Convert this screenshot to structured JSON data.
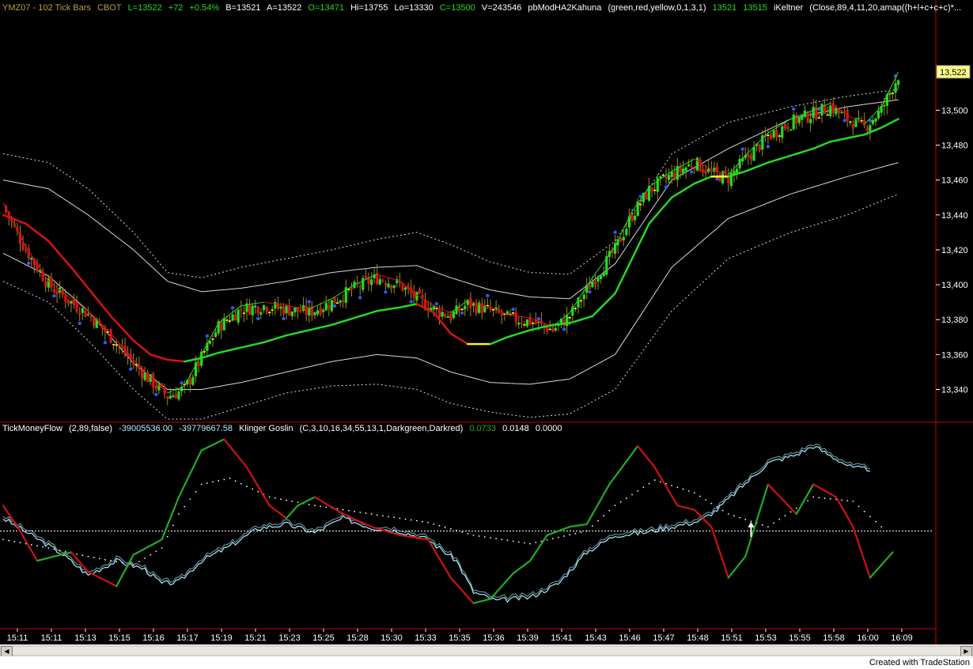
{
  "colors": {
    "background": "#000000",
    "up_candle": "#22dd22",
    "down_candle": "#dd1111",
    "neutral_candle": "#ffff00",
    "wick": "#a08c20",
    "dot": "#3355ff",
    "ma_green": "#22dd22",
    "ma_red": "#dd1111",
    "ma_yellow": "#ffff00",
    "band": "#d8d8d8",
    "moneyflow": "#aaeeff",
    "klinger_up": "#22aa22",
    "klinger_down": "#cc1111",
    "axis_line": "#cc0000"
  },
  "header": {
    "symbol": "YMZ07 - 102 Tick Bars",
    "exchange": "CBOT",
    "last": "L=13522",
    "change": "+72",
    "change_pct": "+0.54%",
    "bid": "B=13521",
    "ask": "A=13522",
    "open": "O=13471",
    "high": "Hi=13755",
    "low": "Lo=13330",
    "close": "C=13500",
    "volume": "V=243546",
    "study1": "pbModHA2Kahuna",
    "study1_params": "(green,red,yellow,0,1,3,1)",
    "study1_v1": "13521",
    "study1_v2": "13515",
    "study2": "iKeltner",
    "study2_params": "(Close,89,4,11,20,amap((h+l+c+c+c)*..."
  },
  "sub_header": {
    "study1": "TickMoneyFlow",
    "study1_params": "(2,89,false)",
    "study1_v1": "-39005536.00",
    "study1_v2": "-39779667.58",
    "study2": "Klinger Goslin",
    "study2_params": "(C,3,10,16,34,55,13,1,Darkgreen,Darkred)",
    "study2_v1": "0.0733",
    "study2_v2": "0.0148",
    "study2_v3": "0.0000"
  },
  "footer": {
    "text": "Created with TradeStation"
  },
  "chart_data": [
    {
      "type": "candlestick",
      "title": "",
      "price_label": "13,522",
      "y_ticks": [
        "13,340",
        "13,360",
        "13,380",
        "13,400",
        "13,420",
        "13,440",
        "13,460",
        "13,480",
        "13,500"
      ],
      "y_tick_values": [
        13340,
        13360,
        13380,
        13400,
        13420,
        13440,
        13460,
        13480,
        13500
      ],
      "ylim": [
        13323,
        13555
      ],
      "last_price": 13522,
      "x_ticks": [
        "15:11",
        "15:11",
        "15:13",
        "15:15",
        "15:16",
        "15:17",
        "15:19",
        "15:21",
        "15:23",
        "15:25",
        "15:28",
        "15:30",
        "15:33",
        "15:35",
        "15:36",
        "15:39",
        "15:41",
        "15:43",
        "15:46",
        "15:47",
        "15:48",
        "15:51",
        "15:53",
        "15:55",
        "15:58",
        "16:00",
        "16:09"
      ],
      "close_path": [
        [
          0,
          13445
        ],
        [
          8,
          13420
        ],
        [
          16,
          13400
        ],
        [
          24,
          13390
        ],
        [
          30,
          13383
        ],
        [
          38,
          13370
        ],
        [
          46,
          13355
        ],
        [
          52,
          13345
        ],
        [
          58,
          13336
        ],
        [
          64,
          13340
        ],
        [
          70,
          13358
        ],
        [
          76,
          13376
        ],
        [
          84,
          13386
        ],
        [
          92,
          13388
        ],
        [
          100,
          13386
        ],
        [
          108,
          13384
        ],
        [
          116,
          13390
        ],
        [
          124,
          13398
        ],
        [
          132,
          13404
        ],
        [
          140,
          13400
        ],
        [
          146,
          13392
        ],
        [
          152,
          13386
        ],
        [
          158,
          13382
        ],
        [
          164,
          13389
        ],
        [
          172,
          13385
        ],
        [
          178,
          13381
        ],
        [
          186,
          13379
        ],
        [
          194,
          13374
        ],
        [
          200,
          13382
        ],
        [
          208,
          13402
        ],
        [
          216,
          13420
        ],
        [
          222,
          13440
        ],
        [
          228,
          13454
        ],
        [
          236,
          13463
        ],
        [
          244,
          13470
        ],
        [
          250,
          13464
        ],
        [
          256,
          13461
        ],
        [
          262,
          13472
        ],
        [
          270,
          13485
        ],
        [
          278,
          13493
        ],
        [
          286,
          13498
        ],
        [
          292,
          13502
        ],
        [
          298,
          13495
        ],
        [
          304,
          13490
        ],
        [
          310,
          13500
        ],
        [
          316,
          13520
        ]
      ],
      "ma_path": [
        [
          0,
          13440
        ],
        [
          8,
          13435
        ],
        [
          16,
          13425
        ],
        [
          24,
          13410
        ],
        [
          30,
          13398
        ],
        [
          38,
          13382
        ],
        [
          46,
          13368
        ],
        [
          52,
          13360
        ],
        [
          58,
          13357
        ],
        [
          64,
          13356
        ],
        [
          70,
          13358
        ],
        [
          76,
          13361
        ],
        [
          84,
          13364
        ],
        [
          92,
          13367
        ],
        [
          100,
          13371
        ],
        [
          108,
          13374
        ],
        [
          116,
          13377
        ],
        [
          124,
          13381
        ],
        [
          132,
          13385
        ],
        [
          140,
          13387
        ],
        [
          146,
          13389
        ],
        [
          152,
          13384
        ],
        [
          158,
          13372
        ],
        [
          164,
          13366
        ],
        [
          172,
          13366
        ],
        [
          178,
          13370
        ],
        [
          186,
          13374
        ],
        [
          194,
          13377
        ],
        [
          200,
          13378
        ],
        [
          208,
          13382
        ],
        [
          216,
          13395
        ],
        [
          222,
          13415
        ],
        [
          228,
          13435
        ],
        [
          236,
          13450
        ],
        [
          244,
          13458
        ],
        [
          250,
          13462
        ],
        [
          256,
          13462
        ],
        [
          262,
          13465
        ],
        [
          270,
          13470
        ],
        [
          278,
          13474
        ],
        [
          286,
          13478
        ],
        [
          292,
          13482
        ],
        [
          298,
          13484
        ],
        [
          304,
          13486
        ],
        [
          310,
          13490
        ],
        [
          316,
          13495
        ]
      ],
      "band_inner_upper_path": [
        [
          0,
          13460
        ],
        [
          16,
          13455
        ],
        [
          30,
          13440
        ],
        [
          46,
          13420
        ],
        [
          58,
          13402
        ],
        [
          70,
          13396
        ],
        [
          84,
          13398
        ],
        [
          100,
          13402
        ],
        [
          116,
          13407
        ],
        [
          132,
          13410
        ],
        [
          146,
          13411
        ],
        [
          158,
          13404
        ],
        [
          172,
          13397
        ],
        [
          186,
          13393
        ],
        [
          200,
          13392
        ],
        [
          216,
          13412
        ],
        [
          236,
          13460
        ],
        [
          256,
          13478
        ],
        [
          278,
          13495
        ],
        [
          298,
          13502
        ],
        [
          316,
          13506
        ]
      ],
      "band_inner_lower_path": [
        [
          0,
          13418
        ],
        [
          16,
          13405
        ],
        [
          30,
          13385
        ],
        [
          46,
          13355
        ],
        [
          58,
          13340
        ],
        [
          70,
          13340
        ],
        [
          84,
          13344
        ],
        [
          100,
          13350
        ],
        [
          116,
          13356
        ],
        [
          132,
          13360
        ],
        [
          146,
          13358
        ],
        [
          158,
          13350
        ],
        [
          172,
          13344
        ],
        [
          186,
          13343
        ],
        [
          200,
          13346
        ],
        [
          216,
          13360
        ],
        [
          236,
          13410
        ],
        [
          256,
          13438
        ],
        [
          278,
          13452
        ],
        [
          298,
          13462
        ],
        [
          316,
          13470
        ]
      ],
      "band_outer_upper_path": [
        [
          0,
          13475
        ],
        [
          16,
          13470
        ],
        [
          30,
          13455
        ],
        [
          46,
          13430
        ],
        [
          58,
          13407
        ],
        [
          70,
          13404
        ],
        [
          84,
          13410
        ],
        [
          100,
          13415
        ],
        [
          116,
          13420
        ],
        [
          132,
          13426
        ],
        [
          146,
          13430
        ],
        [
          158,
          13423
        ],
        [
          172,
          13413
        ],
        [
          186,
          13407
        ],
        [
          200,
          13406
        ],
        [
          216,
          13425
        ],
        [
          236,
          13475
        ],
        [
          256,
          13493
        ],
        [
          278,
          13502
        ],
        [
          298,
          13508
        ],
        [
          316,
          13512
        ]
      ],
      "band_outer_lower_path": [
        [
          0,
          13402
        ],
        [
          16,
          13390
        ],
        [
          30,
          13368
        ],
        [
          46,
          13340
        ],
        [
          58,
          13323
        ],
        [
          70,
          13323
        ],
        [
          84,
          13330
        ],
        [
          100,
          13338
        ],
        [
          116,
          13342
        ],
        [
          132,
          13343
        ],
        [
          146,
          13340
        ],
        [
          158,
          13332
        ],
        [
          172,
          13327
        ],
        [
          186,
          13324
        ],
        [
          200,
          13326
        ],
        [
          216,
          13340
        ],
        [
          236,
          13385
        ],
        [
          256,
          13415
        ],
        [
          278,
          13430
        ],
        [
          298,
          13440
        ],
        [
          316,
          13452
        ]
      ]
    },
    {
      "type": "line",
      "title": "",
      "ylim": [
        -1.15,
        1.15
      ],
      "zero_line": 0,
      "series": [
        {
          "name": "TickMoneyFlow",
          "values": [
            [
              0,
              0.15
            ],
            [
              10,
              -0.05
            ],
            [
              20,
              -0.25
            ],
            [
              30,
              -0.52
            ],
            [
              40,
              -0.35
            ],
            [
              50,
              -0.45
            ],
            [
              56,
              -0.62
            ],
            [
              62,
              -0.6
            ],
            [
              70,
              -0.35
            ],
            [
              80,
              -0.18
            ],
            [
              90,
              0.03
            ],
            [
              100,
              0.08
            ],
            [
              110,
              -0.02
            ],
            [
              120,
              0.15
            ],
            [
              130,
              0.04
            ],
            [
              140,
              0.0
            ],
            [
              150,
              -0.1
            ],
            [
              160,
              -0.35
            ],
            [
              166,
              -0.72
            ],
            [
              174,
              -0.82
            ],
            [
              186,
              -0.78
            ],
            [
              196,
              -0.62
            ],
            [
              206,
              -0.25
            ],
            [
              216,
              -0.05
            ],
            [
              226,
              -0.02
            ],
            [
              236,
              0.05
            ],
            [
              246,
              0.12
            ],
            [
              252,
              0.25
            ],
            [
              260,
              0.5
            ],
            [
              270,
              0.8
            ],
            [
              280,
              0.9
            ],
            [
              286,
              1.0
            ],
            [
              294,
              0.85
            ],
            [
              300,
              0.74
            ],
            [
              306,
              0.73
            ]
          ]
        },
        {
          "name": "Klinger Goslin",
          "values": [
            [
              0,
              0.3
            ],
            [
              6,
              0.0
            ],
            [
              12,
              -0.35
            ],
            [
              18,
              -0.3
            ],
            [
              24,
              -0.25
            ],
            [
              30,
              -0.48
            ],
            [
              40,
              -0.65
            ],
            [
              46,
              -0.28
            ],
            [
              56,
              -0.1
            ],
            [
              62,
              0.4
            ],
            [
              70,
              0.95
            ],
            [
              78,
              1.08
            ],
            [
              86,
              0.75
            ],
            [
              94,
              0.3
            ],
            [
              100,
              0.15
            ],
            [
              104,
              0.3
            ],
            [
              110,
              0.4
            ],
            [
              120,
              0.2
            ],
            [
              130,
              0.05
            ],
            [
              140,
              -0.05
            ],
            [
              150,
              -0.1
            ],
            [
              158,
              -0.55
            ],
            [
              166,
              -0.85
            ],
            [
              172,
              -0.8
            ],
            [
              180,
              -0.5
            ],
            [
              186,
              -0.35
            ],
            [
              192,
              -0.05
            ],
            [
              200,
              0.05
            ],
            [
              206,
              0.08
            ],
            [
              214,
              0.55
            ],
            [
              224,
              1.0
            ],
            [
              230,
              0.75
            ],
            [
              238,
              0.3
            ],
            [
              244,
              0.25
            ],
            [
              250,
              0.05
            ],
            [
              256,
              -0.55
            ],
            [
              262,
              -0.3
            ],
            [
              270,
              0.55
            ],
            [
              280,
              0.2
            ],
            [
              286,
              0.55
            ],
            [
              294,
              0.4
            ],
            [
              300,
              0.05
            ],
            [
              306,
              -0.55
            ],
            [
              314,
              -0.25
            ]
          ]
        },
        {
          "name": "",
          "values": [
            [
              0,
              -0.1
            ],
            [
              16,
              -0.2
            ],
            [
              30,
              -0.3
            ],
            [
              46,
              -0.4
            ],
            [
              56,
              -0.2
            ],
            [
              62,
              0.2
            ],
            [
              70,
              0.55
            ],
            [
              80,
              0.62
            ],
            [
              94,
              0.4
            ],
            [
              110,
              0.3
            ],
            [
              130,
              0.2
            ],
            [
              150,
              0.1
            ],
            [
              166,
              -0.05
            ],
            [
              186,
              -0.15
            ],
            [
              206,
              0.0
            ],
            [
              216,
              0.3
            ],
            [
              230,
              0.6
            ],
            [
              244,
              0.45
            ],
            [
              256,
              0.2
            ],
            [
              270,
              0.05
            ],
            [
              286,
              0.4
            ],
            [
              300,
              0.35
            ],
            [
              310,
              0.05
            ]
          ]
        }
      ]
    }
  ]
}
